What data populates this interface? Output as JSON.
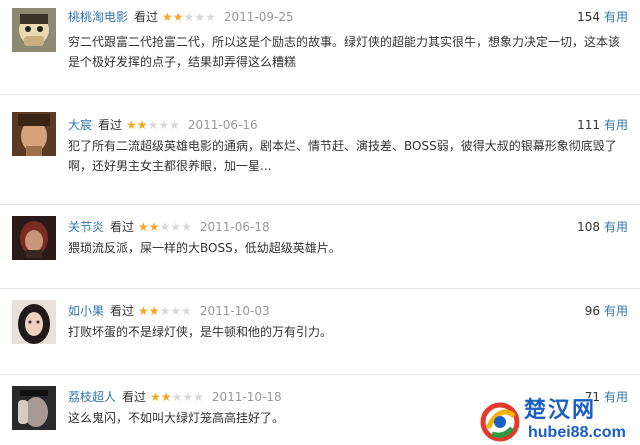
{
  "reviews": [
    {
      "user": "桃桃淘电影",
      "status": "看过",
      "rating": 2,
      "date": "2011-09-25",
      "useful_count": "154",
      "useful_label": "有用",
      "text": "穷二代跟富二代抢富二代，所以这是个励志的故事。绿灯侠的超能力其实很牛，想象力决定一切，这本该是个极好发挥的点子，结果却弄得这么糟糕"
    },
    {
      "user": "大宸",
      "status": "看过",
      "rating": 2,
      "date": "2011-06-16",
      "useful_count": "111",
      "useful_label": "有用",
      "text": "犯了所有二流超级英雄电影的通病，剧本烂、情节赶、演技差、BOSS弱，彼得大叔的银幕形象彻底毁了啊，还好男主女主都很养眼，加一星..."
    },
    {
      "user": "关节炎",
      "status": "看过",
      "rating": 2,
      "date": "2011-06-18",
      "useful_count": "108",
      "useful_label": "有用",
      "text": "猥琐流反派，屎一样的大BOSS，低幼超级英雄片。"
    },
    {
      "user": "如小果",
      "status": "看过",
      "rating": 2,
      "date": "2011-10-03",
      "useful_count": "96",
      "useful_label": "有用",
      "text": "打败坏蛋的不是绿灯侠，是牛顿和他的万有引力。"
    },
    {
      "user": "荔枝超人",
      "status": "看过",
      "rating": 2,
      "date": "2011-10-18",
      "useful_count": "71",
      "useful_label": "有用",
      "text": "这么鬼闪，不如叫大绿灯笼高高挂好了。"
    }
  ],
  "max_rating": 5,
  "colors": {
    "link": "#3377aa",
    "star_on": "#f5a623",
    "star_off": "#d8d8d8",
    "date": "#999999"
  },
  "watermark": {
    "name": "楚汉网",
    "url": "hubei88.com"
  }
}
